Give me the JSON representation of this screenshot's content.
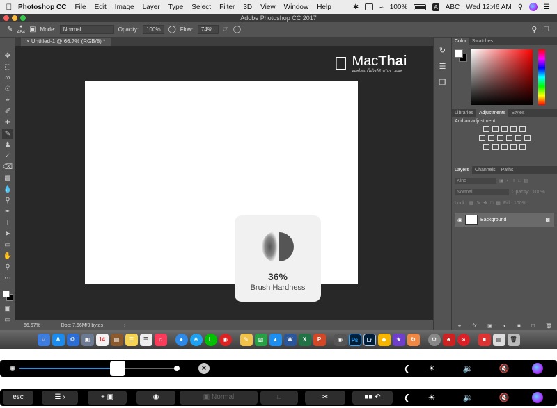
{
  "menubar": {
    "app_name": "Photoshop CC",
    "menus": [
      "File",
      "Edit",
      "Image",
      "Layer",
      "Type",
      "Select",
      "Filter",
      "3D",
      "View",
      "Window",
      "Help"
    ],
    "battery_pct": "100%",
    "input_badge": "A",
    "input_label": "ABC",
    "clock": "Wed 12:46 AM"
  },
  "window": {
    "title": "Adobe Photoshop CC 2017"
  },
  "options": {
    "brush_size": "484",
    "mode_label": "Mode:",
    "mode_value": "Normal",
    "opacity_label": "Opacity:",
    "opacity_value": "100%",
    "flow_label": "Flow:",
    "flow_value": "74%"
  },
  "document": {
    "tab_title": "Untitled-1 @ 66.7% (RGB/8) *",
    "zoom": "66.67%",
    "doc_info": "Doc: 7.66M/0 bytes"
  },
  "watermark": {
    "brand_plain": "Mac",
    "brand_bold": "Thai",
    "tagline": "แมคไทย: เว็บไซต์สำหรับชาวแมค"
  },
  "hud": {
    "percent": "36%",
    "label": "Brush Hardness"
  },
  "panels": {
    "color_tabs": [
      "Color",
      "Swatches"
    ],
    "adj_tabs": [
      "Libraries",
      "Adjustments",
      "Styles"
    ],
    "adj_title": "Add an adjustment",
    "layer_tabs": [
      "Layers",
      "Channels",
      "Paths"
    ],
    "kind_placeholder": "Kind",
    "blend_mode": "Normal",
    "opacity_label": "Opacity:",
    "lock_label": "Lock:",
    "fill_label": "Fill:",
    "percent_value": "100%",
    "layer_name": "Background"
  },
  "touchbar": {
    "esc": "esc",
    "normal": "Normal"
  }
}
